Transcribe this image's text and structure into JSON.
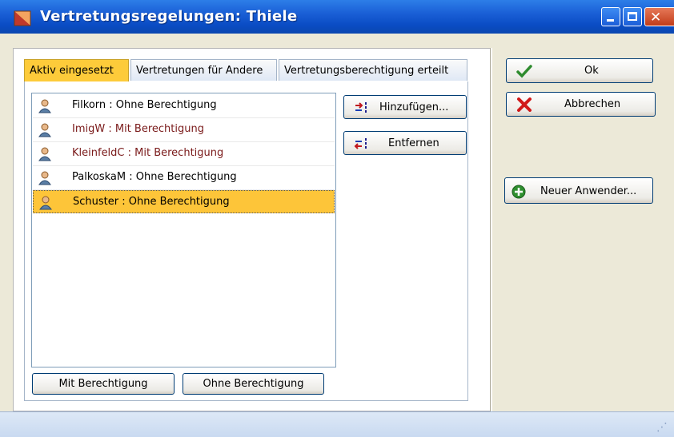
{
  "window": {
    "title": "Vertretungsregelungen: Thiele"
  },
  "tabs": [
    {
      "label": "Aktiv eingesetzt",
      "active": true
    },
    {
      "label": "Vertretungen für Andere",
      "active": false
    },
    {
      "label": "Vertretungsberechtigung erteilt",
      "active": false
    }
  ],
  "list": {
    "items": [
      {
        "label": "Filkorn  : Ohne Berechtigung",
        "style": "normal"
      },
      {
        "label": "ImigW  : Mit Berechtigung",
        "style": "red"
      },
      {
        "label": "KleinfeldC  : Mit Berechtigung",
        "style": "red"
      },
      {
        "label": "PalkoskaM  : Ohne Berechtigung",
        "style": "normal"
      },
      {
        "label": "Schuster  : Ohne Berechtigung",
        "style": "selected"
      }
    ]
  },
  "actions": {
    "add": "Hinzufügen...",
    "remove": "Entfernen"
  },
  "filters": {
    "mit": "Mit Berechtigung",
    "ohne": "Ohne Berechtigung"
  },
  "side": {
    "ok": "Ok",
    "cancel": "Abbrechen",
    "new_user": "Neuer Anwender..."
  },
  "icons": {
    "title": "window-app-icon",
    "ok": "checkmark-icon",
    "cancel": "red-x-icon",
    "new_user": "green-plus-icon",
    "add": "add-arrow-icon",
    "remove": "remove-arrow-icon",
    "user": "user-icon"
  },
  "colors": {
    "titlebar": "#0a4cc4",
    "selection": "#fdc539",
    "active_tab": "#fdcb3a",
    "red_text": "#7a1a1a"
  }
}
